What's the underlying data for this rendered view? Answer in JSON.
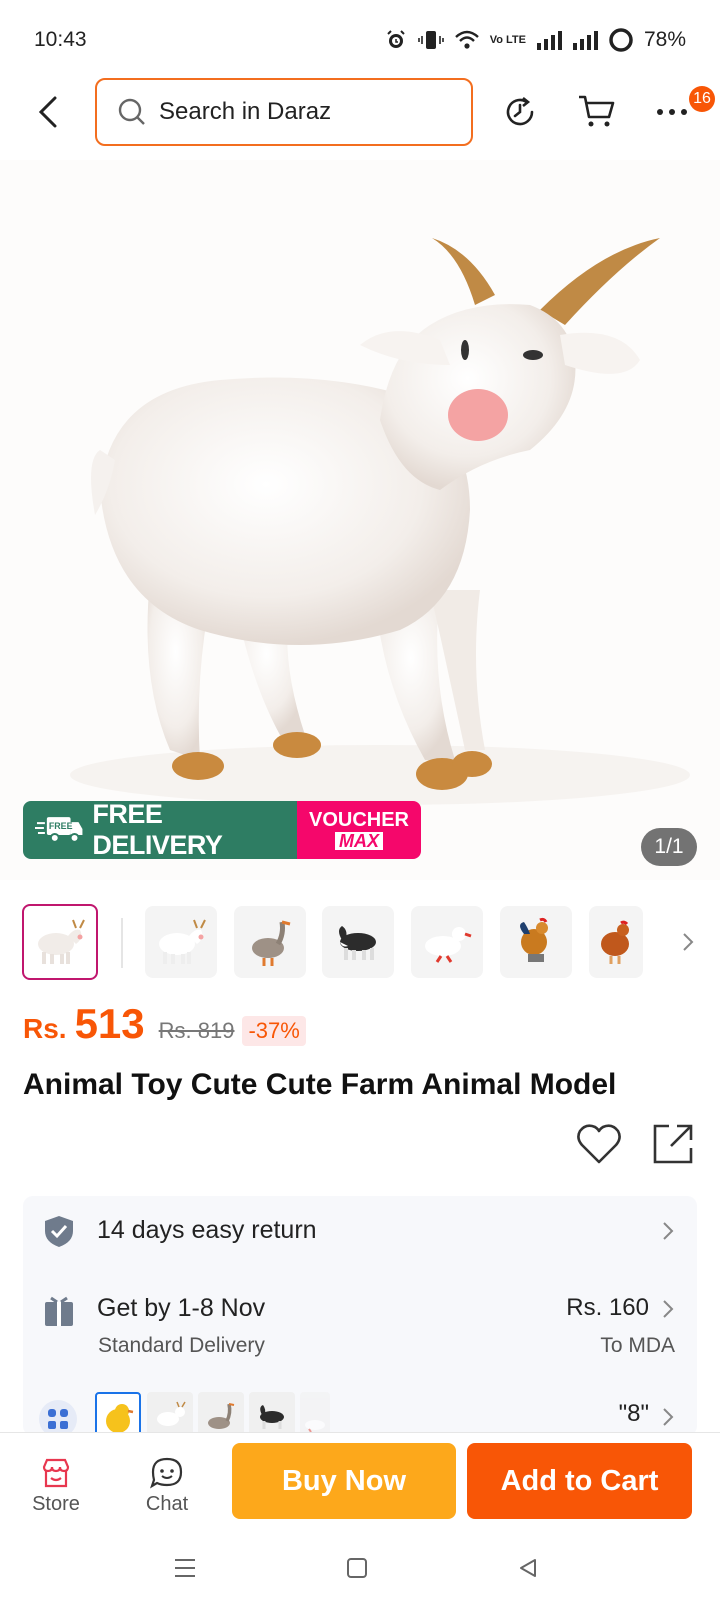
{
  "status_bar": {
    "time": "10:43",
    "battery": "78%",
    "network_label": "Vo LTE"
  },
  "header": {
    "search_placeholder": "Search in Daraz",
    "more_badge_count": "16"
  },
  "gallery": {
    "banner_free_delivery": "FREE DELIVERY",
    "banner_free_tag": "FREE",
    "banner_voucher": "VOUCHER",
    "banner_max": "MAX",
    "page_indicator": "1/1",
    "thumbnails": [
      "goat",
      "goat",
      "goose",
      "dog",
      "duck",
      "rooster",
      "hen"
    ]
  },
  "product": {
    "currency": "Rs.",
    "price": "513",
    "original_price": "Rs. 819",
    "discount": "-37%",
    "title": "Animal Toy Cute Cute Farm Animal Model"
  },
  "services": {
    "returns_label": "14 days easy return",
    "delivery_label": "Get by 1-8 Nov",
    "delivery_type": "Standard Delivery",
    "delivery_fee": "Rs. 160",
    "delivery_location": "To MDA",
    "variant_selected": "\"8\""
  },
  "bottom_bar": {
    "store_label": "Store",
    "chat_label": "Chat",
    "buy_now_label": "Buy Now",
    "add_to_cart_label": "Add to Cart"
  },
  "colors": {
    "brand_orange": "#f85606",
    "buy_now": "#fda81b",
    "delivery_green": "#2e7d63",
    "voucher_pink": "#f5076b"
  }
}
